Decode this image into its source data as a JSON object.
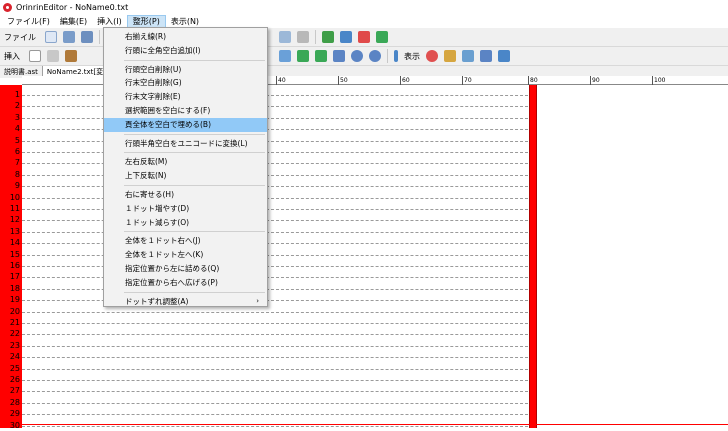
{
  "window": {
    "title": "OrinrinEditor - NoName0.txt"
  },
  "menubar": [
    "ファイル(F)",
    "編集(E)",
    "挿入(I)",
    "整形(P)",
    "表示(N)"
  ],
  "toolbar1": {
    "label": "ファイル"
  },
  "toolbar2": {
    "label": "挿入",
    "view_label": "表示"
  },
  "tabs": [
    "説明書.ast",
    "NoName2.txt[変更]"
  ],
  "ruler": [
    "40",
    "50",
    "60",
    "70",
    "80",
    "90",
    "100"
  ],
  "line_numbers": [
    "1",
    "2",
    "3",
    "4",
    "5",
    "6",
    "7",
    "8",
    "9",
    "10",
    "11",
    "12",
    "13",
    "14",
    "15",
    "16",
    "17",
    "18",
    "19",
    "20",
    "21",
    "22",
    "23",
    "24",
    "25",
    "26",
    "27",
    "28",
    "29",
    "30"
  ],
  "dropdown": {
    "groups": [
      [
        "右揃え線(R)",
        "行頭に全角空白追加(I)"
      ],
      [
        "行頭空白削除(U)",
        "行末空白削除(G)",
        "行末文字削除(E)",
        "選択範囲を空白にする(F)",
        "頁全体を空白で埋める(B)"
      ],
      [
        "行頭半角空白をユニコードに変換(L)"
      ],
      [
        "左右反転(M)",
        "上下反転(N)"
      ],
      [
        "右に寄せる(H)",
        "１ドット増やす(D)",
        "１ドット減らす(O)"
      ],
      [
        "全体を１ドット右へ(J)",
        "全体を１ドット左へ(K)",
        "指定位置から左に詰める(Q)",
        "指定位置から右へ広げる(P)"
      ],
      [
        "ドットずれ調整(A)"
      ]
    ],
    "highlighted": "頁全体を空白で埋める(B)",
    "submenu_item": "ドットずれ調整(A)",
    "submenu_arrow": "›"
  },
  "colors": {
    "gutter": "#ff0000",
    "highlight": "#91c9f7"
  }
}
